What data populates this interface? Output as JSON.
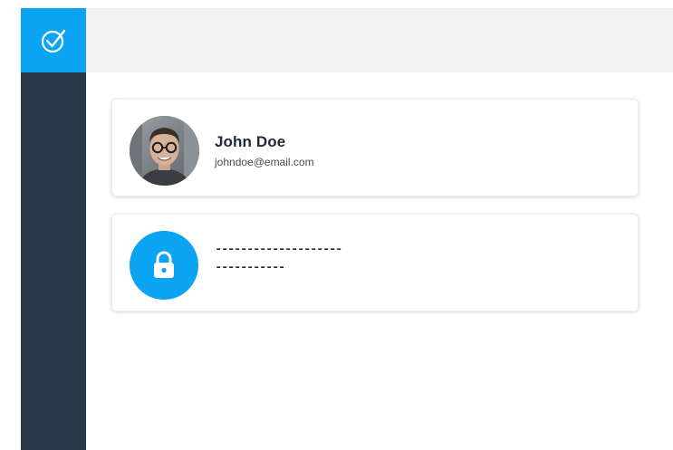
{
  "sidebar": {
    "logo_icon": "check-circle-icon",
    "background_color": "#2a3a49",
    "logo_background_color": "#0aa4f3"
  },
  "topbar": {
    "background_color": "#f2f2f2"
  },
  "profile_card": {
    "avatar_icon": "user-avatar",
    "name": "John Doe",
    "email": "johndoe@email.com"
  },
  "password_card": {
    "icon": "lock-icon",
    "icon_color": "#0aa4f3",
    "line_1": "--------------------",
    "line_2": "-----------"
  }
}
